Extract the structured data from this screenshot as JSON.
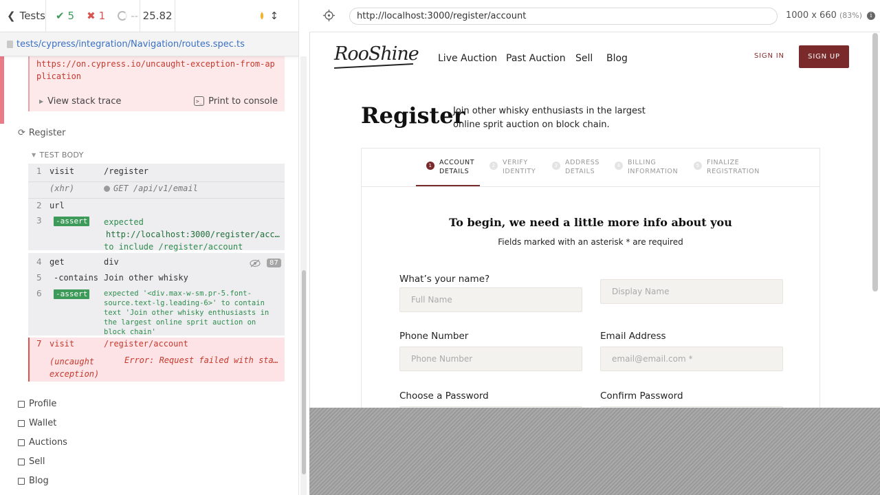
{
  "reporter": {
    "tests_label": "Tests",
    "passed": "5",
    "failed": "1",
    "pending": "--",
    "duration": "25.82",
    "spec_path": "tests/cypress/integration/Navigation/routes.spec.ts",
    "error_link": "https://on.cypress.io/uncaught-exception-from-application",
    "view_stack_trace": "View stack trace",
    "print_to_console": "Print to console",
    "test_title": "Register",
    "test_body_label": "TEST BODY",
    "commands": [
      {
        "num": "1",
        "name": "visit",
        "msg": "/register"
      },
      {
        "num": "",
        "name": "(xhr)",
        "msg": "GET /api/v1/email"
      },
      {
        "num": "2",
        "name": "url",
        "msg": ""
      },
      {
        "num": "3",
        "name": "-assert",
        "msg_line1": "expected",
        "msg_line2": "http://localhost:3000/register/acc…",
        "msg_line3": "to include  /register/account"
      },
      {
        "num": "4",
        "name": "get",
        "msg": "div",
        "badge": "87"
      },
      {
        "num": "5",
        "name": "-contains",
        "msg": "Join other whisky"
      },
      {
        "num": "6",
        "name": "-assert",
        "msg": "expected  '<div.max-w-sm.pr-5.font-source.text-lg.leading-6>'  to contain text  'Join other whisky enthusiasts in the largest online sprit auction on block chain'"
      },
      {
        "num": "7",
        "name": "visit",
        "msg": "/register/account"
      },
      {
        "num": "",
        "name": "(uncaught exception)",
        "msg": "Error: Request failed with sta…"
      }
    ],
    "siblings": [
      "Profile",
      "Wallet",
      "Auctions",
      "Sell",
      "Blog"
    ]
  },
  "aut": {
    "url": "http://localhost:3000/register/account",
    "viewport_size": "1000 x 660",
    "viewport_scale": "(83%)",
    "info_glyph": "i"
  },
  "site": {
    "logo": "RooShine",
    "nav": [
      "Live Auction",
      "Past Auction",
      "Sell",
      "Blog"
    ],
    "sign_in": "SIGN IN",
    "sign_up": "SIGN UP",
    "title": "Register",
    "subtitle": "Join other whisky enthusiasts in the largest online sprit auction on block chain.",
    "steps": [
      {
        "num": "1",
        "line1": "ACCOUNT",
        "line2": "DETAILS",
        "active": true
      },
      {
        "num": "2",
        "line1": "VERIFY",
        "line2": "IDENTITY",
        "active": false
      },
      {
        "num": "3",
        "line1": "ADDRESS",
        "line2": "DETAILS",
        "active": false
      },
      {
        "num": "4",
        "line1": "BILLING",
        "line2": "INFORMATION",
        "active": false
      },
      {
        "num": "5",
        "line1": "FINALIZE",
        "line2": "REGISTRATION",
        "active": false
      }
    ],
    "form_heading": "To begin, we need a little more info about you",
    "form_subheading": "Fields marked with an asterisk * are required",
    "fields": {
      "name_label": "What’s your name?",
      "full_name_placeholder": "Full Name",
      "display_name_placeholder": "Display Name",
      "phone_label": "Phone Number",
      "phone_placeholder": "Phone Number",
      "email_label": "Email Address",
      "email_placeholder": "email@email.com *",
      "password_label": "Choose a Password",
      "confirm_label": "Confirm Password"
    }
  },
  "colors": {
    "brand": "#7a2a2a",
    "pass": "#3d9a59",
    "fail": "#d9534f",
    "link": "#3a6fc5"
  }
}
